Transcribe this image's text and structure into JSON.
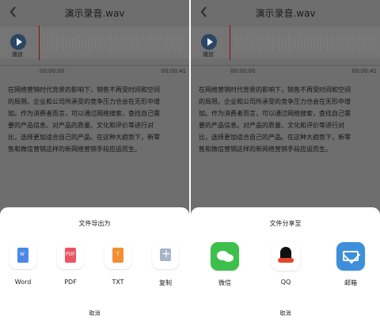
{
  "left": {
    "title": "演示录音.wav",
    "play_label": "播放",
    "time_start": "00:00:00",
    "time_end": "00:00:41",
    "body": "在网络营销时代背景的影响下，销售不再受时间和空间\n的局限。企业和公司所承受的竞争压力也会在无形中增\n加。作为消费者而言，可以通过网络搜索，查找自己需\n要的产品信息。对产品的质量、文化和评价等进行对\n比，选择更加适合自己的产品。在这种大趋势下，新零\n售和微信营销这样的新网络营销手段应运而生。",
    "sheet_title": "文件导出为",
    "items": [
      {
        "label": "Word",
        "icon": "word-icon",
        "mini": "W"
      },
      {
        "label": "PDF",
        "icon": "pdf-icon",
        "mini": "PDF"
      },
      {
        "label": "TXT",
        "icon": "txt-icon",
        "mini": "T"
      },
      {
        "label": "复制",
        "icon": "copy-icon",
        "mini": ""
      }
    ],
    "cancel": "取消"
  },
  "right": {
    "title": "演示录音.wav",
    "play_label": "播放",
    "time_start": "00:00:00",
    "time_end": "00:00:41",
    "body": "在网络营销时代背景的影响下，销售不再受时间和空间\n的局限。企业和公司所承受的竞争压力也会在无形中增\n加。作为消费者而言，可以通过网络搜索，查找自己需\n要的产品信息。对产品的质量、文化和评价等进行对\n比，选择更加适合自己的产品。在这种大趋势下，新零\n售和微信营销这样的新网络营销手段应运而生。",
    "sheet_title": "文件分享至",
    "items": [
      {
        "label": "微信",
        "icon": "wechat-icon"
      },
      {
        "label": "QQ",
        "icon": "qq-icon"
      },
      {
        "label": "邮箱",
        "icon": "mail-icon"
      }
    ],
    "cancel": "取消"
  },
  "colors": {
    "overlay": "#6e6e6e",
    "playhead": "#8b0e0e",
    "play_button": "#2b4563"
  }
}
